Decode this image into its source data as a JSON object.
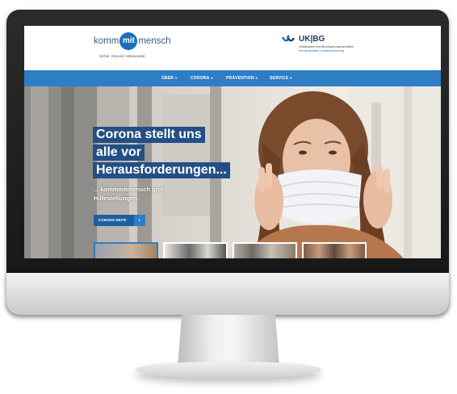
{
  "site": {
    "logo": {
      "word1": "komm",
      "word2": "mit",
      "word3": "mensch",
      "tagline": "Sicher. Gesund. Miteinander."
    },
    "partner": {
      "name": "UK|BG",
      "sub1": "Unfallkassen und Berufsgenossenschaften",
      "sub2": "Ihre gesetzliche Unfallversicherung"
    }
  },
  "nav": {
    "items": [
      {
        "label": "ÜBER"
      },
      {
        "label": "CORONA"
      },
      {
        "label": "PRÄVENTION"
      },
      {
        "label": "SERVICE"
      }
    ]
  },
  "hero": {
    "headline": [
      "Corona stellt uns",
      "alle vor",
      "Herausforderungen..."
    ],
    "subline": [
      "... kommmitmensch gibt",
      "Hilfestellungen."
    ],
    "cta_label": "CORONA-SEITE",
    "cta_arrow": "›"
  },
  "colors": {
    "accent": "#2d7ec4",
    "headline_bg": "#234f86",
    "brand_text": "#3d5a80"
  },
  "icons": {
    "partner_mark": "ukbg-logo-mark",
    "cta": "chevron-right-icon",
    "nav_caret": "caret-down-icon"
  }
}
